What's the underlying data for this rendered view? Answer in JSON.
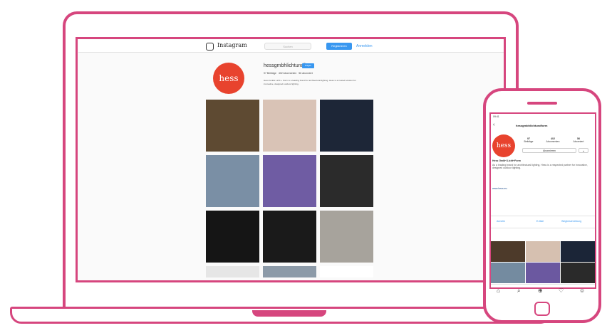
{
  "laptop": {
    "topbar": {
      "logo_text": "Instagram",
      "search_placeholder": "Suchen",
      "signup_label": "Registrieren",
      "login_label": "Anmelden"
    },
    "profile": {
      "avatar_text": "hess",
      "username": "hessgmbhlichtundform",
      "follow_label": "Folgen",
      "stats": [
        "97 Beiträge",
        "402 Abonnenten",
        "56 abonniert"
      ],
      "bio": "Hess GmbH Licht + Form is a leading brand for architectural lighting. Hess is a trusted solution for innovative, designed outdoor lighting."
    },
    "grid": [
      {
        "name": "post-speaker-stage",
        "color": "#5e4a32"
      },
      {
        "name": "post-collage",
        "color": "#d9c3b6"
      },
      {
        "name": "post-hess-women",
        "color": "#1d2637"
      },
      {
        "name": "post-bench",
        "color": "#7a8fa5"
      },
      {
        "name": "post-waffle",
        "color": "#6f5ca3"
      },
      {
        "name": "post-dc-paris",
        "color": "#2b2b2b"
      },
      {
        "name": "post-night-light",
        "color": "#151515"
      },
      {
        "name": "post-panel",
        "color": "#1a1a1a"
      },
      {
        "name": "post-industrial",
        "color": "#a7a39c"
      },
      {
        "name": "post-text",
        "color": "#e6e6e6"
      },
      {
        "name": "post-building",
        "color": "#8c9aa8"
      },
      {
        "name": "post-blank",
        "color": "#ffffff"
      }
    ]
  },
  "phone": {
    "status_time": "09:41",
    "username": "hessgmbhlichtundform",
    "avatar_text": "hess",
    "stats": [
      {
        "num": "97",
        "label": "Beiträge"
      },
      {
        "num": "402",
        "label": "Abonnenten"
      },
      {
        "num": "56",
        "label": "Abonniert"
      }
    ],
    "follow_label": "Abonnieren",
    "bio_name": "Hess GmbH Licht+Form",
    "bio": "As a leading brand for architectural lighting, Hess is a respected partner for innovative, designed outdoor lighting.",
    "link": "www.hess.eu",
    "tabs": [
      "Anrufen",
      "E-Mail",
      "Wegbeschreibung"
    ],
    "grid_colors": [
      "#4d3a2a",
      "#d6c0b0",
      "#1b2537",
      "#748ba0",
      "#6b58a0",
      "#2a2a2a"
    ],
    "nav_icons": [
      "home-icon",
      "search-icon",
      "add-icon",
      "heart-icon",
      "profile-icon"
    ]
  }
}
